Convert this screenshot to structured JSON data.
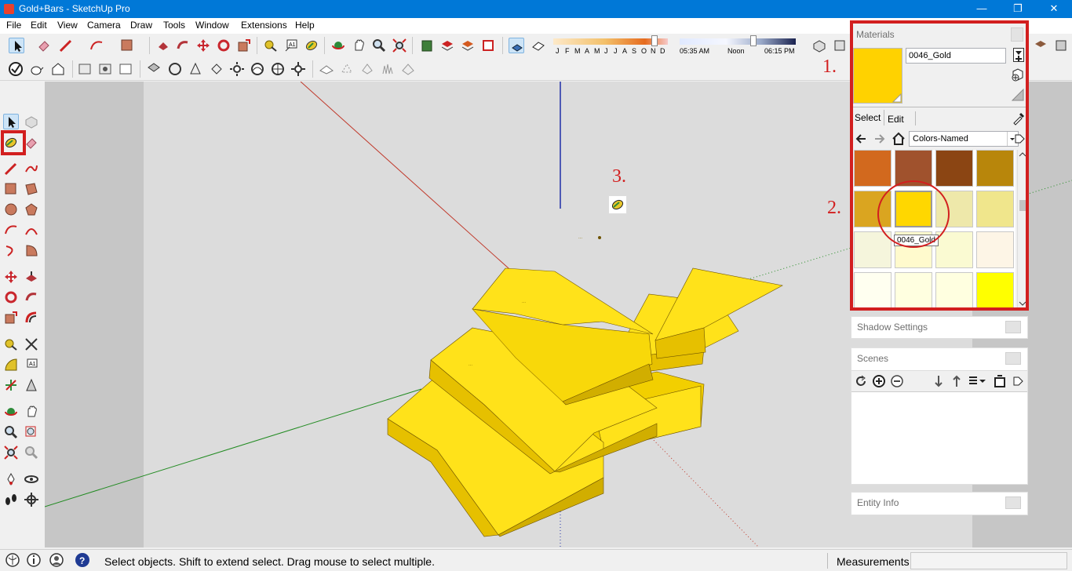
{
  "window": {
    "title": "Gold+Bars - SketchUp Pro",
    "controls": [
      "—",
      "❐",
      "✕"
    ]
  },
  "menu": [
    "File",
    "Edit",
    "View",
    "Camera",
    "Draw",
    "Tools",
    "Window",
    "Extensions",
    "Help"
  ],
  "shadow_bar": {
    "months": [
      "J",
      "F",
      "M",
      "A",
      "M",
      "J",
      "J",
      "A",
      "S",
      "O",
      "N",
      "D"
    ],
    "time_start": "05:35 AM",
    "time_noon": "Noon",
    "time_end": "06:15 PM"
  },
  "materials": {
    "title": "Materials",
    "current_name": "0046_Gold",
    "current_color": "#ffd200",
    "tabs": [
      "Select",
      "Edit"
    ],
    "library": "Colors-Named",
    "tooltip": "0046_Gold",
    "swatches": [
      "#d2691e",
      "#a0522d",
      "#8b4513",
      "#b8860b",
      "#daa520",
      "#ffd700",
      "#eee8aa",
      "#f0e68c",
      "#f5f5dc",
      "#fffacd",
      "#fafad2",
      "#fdf5e6",
      "#fffff0",
      "#ffffe0",
      "#ffffe0",
      "#ffff00"
    ]
  },
  "panels": {
    "shadow": "Shadow Settings",
    "scenes": "Scenes",
    "entity": "Entity Info"
  },
  "annotations": [
    "1.",
    "2.",
    "3."
  ],
  "status": {
    "message": "Select objects. Shift to extend select. Drag mouse to select multiple.",
    "measurements_label": "Measurements",
    "measurements_value": ""
  },
  "colors": {
    "titlebar": "#0078d7",
    "highlight": "#d21f1f",
    "gold": "#ffd200"
  }
}
